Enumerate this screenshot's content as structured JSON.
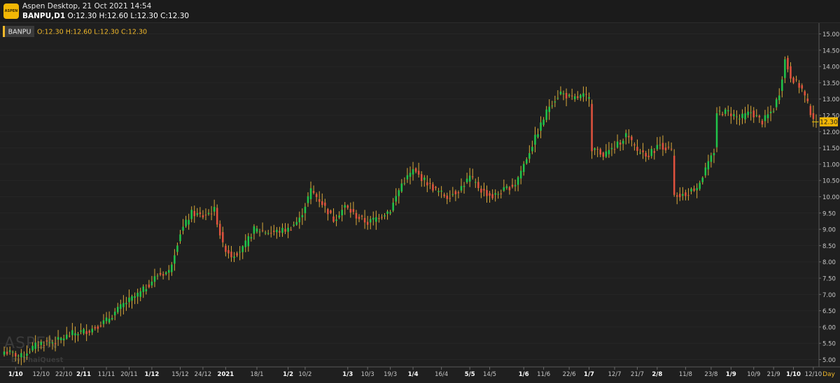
{
  "window": {
    "title": "Aspen Desktop, 21 Oct 2021 14:54",
    "symbol_line": "BANPU,D1",
    "ohlc_line": "O:12.30 H:12.60 L:12.30 C:12.30",
    "app_icon_label": "ASPEN"
  },
  "legend": {
    "symbol": "BANPU",
    "ohlc": "O:12.30 H:12.60 L:12.30 C:12.30"
  },
  "watermark": {
    "brand": "ASPEN",
    "sub": "by ThaiQuest"
  },
  "colors": {
    "up": "#21c44a",
    "down": "#e0523e",
    "wick": "#d9a93a",
    "legend_text": "#f0b82a",
    "price_tag": "#f2b705",
    "axis_text": "#c8c8c8"
  },
  "chart_data": {
    "type": "candlestick",
    "symbol": "BANPU",
    "timeframe": "D1",
    "title": "BANPU,D1",
    "ylim": [
      4.75,
      15.1
    ],
    "y_ticks": [
      5.0,
      5.5,
      6.0,
      6.5,
      7.0,
      7.5,
      8.0,
      8.5,
      9.0,
      9.5,
      10.0,
      10.5,
      11.0,
      11.5,
      12.0,
      12.5,
      13.0,
      13.5,
      14.0,
      14.5,
      15.0
    ],
    "last_price": "12.30",
    "period_label": "Day",
    "x_ticks": [
      {
        "label": "1/10",
        "bold": true
      },
      {
        "label": "12/10",
        "bold": false
      },
      {
        "label": "22/10",
        "bold": false
      },
      {
        "label": "2/11",
        "bold": true
      },
      {
        "label": "11/11",
        "bold": false
      },
      {
        "label": "20/11",
        "bold": false
      },
      {
        "label": "1/12",
        "bold": true
      },
      {
        "label": "15/12",
        "bold": false
      },
      {
        "label": "24/12",
        "bold": false
      },
      {
        "label": "2021",
        "bold": true
      },
      {
        "label": "18/1",
        "bold": false
      },
      {
        "label": "1/2",
        "bold": true
      },
      {
        "label": "10/2",
        "bold": false
      },
      {
        "label": "1/3",
        "bold": true
      },
      {
        "label": "10/3",
        "bold": false
      },
      {
        "label": "19/3",
        "bold": false
      },
      {
        "label": "1/4",
        "bold": true
      },
      {
        "label": "16/4",
        "bold": false
      },
      {
        "label": "5/5",
        "bold": true
      },
      {
        "label": "14/5",
        "bold": false
      },
      {
        "label": "1/6",
        "bold": true
      },
      {
        "label": "11/6",
        "bold": false
      },
      {
        "label": "22/6",
        "bold": false
      },
      {
        "label": "1/7",
        "bold": true
      },
      {
        "label": "12/7",
        "bold": false
      },
      {
        "label": "21/7",
        "bold": false
      },
      {
        "label": "2/8",
        "bold": true
      },
      {
        "label": "11/8",
        "bold": false
      },
      {
        "label": "23/8",
        "bold": false
      },
      {
        "label": "1/9",
        "bold": true
      },
      {
        "label": "10/9",
        "bold": false
      },
      {
        "label": "21/9",
        "bold": false
      },
      {
        "label": "1/10",
        "bold": true
      },
      {
        "label": "12/10",
        "bold": false
      }
    ],
    "tick_bar_index": [
      4,
      13,
      21,
      28,
      36,
      44,
      52,
      62,
      70,
      78,
      89,
      100,
      106,
      121,
      128,
      136,
      144,
      154,
      164,
      171,
      183,
      190,
      199,
      206,
      215,
      223,
      230,
      240,
      249,
      256,
      264,
      271,
      278,
      285
    ],
    "close_anchors": [
      [
        0,
        5.25
      ],
      [
        6,
        5.1
      ],
      [
        12,
        5.5
      ],
      [
        18,
        5.55
      ],
      [
        24,
        5.8
      ],
      [
        30,
        5.9
      ],
      [
        36,
        6.2
      ],
      [
        42,
        6.7
      ],
      [
        48,
        7.05
      ],
      [
        54,
        7.6
      ],
      [
        58,
        7.7
      ],
      [
        62,
        8.9
      ],
      [
        66,
        9.5
      ],
      [
        70,
        9.4
      ],
      [
        74,
        9.6
      ],
      [
        77,
        8.5
      ],
      [
        80,
        8.2
      ],
      [
        84,
        8.4
      ],
      [
        88,
        9.0
      ],
      [
        94,
        8.9
      ],
      [
        100,
        9.0
      ],
      [
        104,
        9.3
      ],
      [
        108,
        10.2
      ],
      [
        112,
        9.8
      ],
      [
        116,
        9.3
      ],
      [
        120,
        9.7
      ],
      [
        124,
        9.4
      ],
      [
        128,
        9.2
      ],
      [
        132,
        9.4
      ],
      [
        136,
        9.6
      ],
      [
        140,
        10.4
      ],
      [
        144,
        10.8
      ],
      [
        148,
        10.5
      ],
      [
        152,
        10.2
      ],
      [
        156,
        10.0
      ],
      [
        160,
        10.2
      ],
      [
        164,
        10.6
      ],
      [
        168,
        10.2
      ],
      [
        172,
        10.0
      ],
      [
        176,
        10.2
      ],
      [
        180,
        10.4
      ],
      [
        184,
        11.2
      ],
      [
        188,
        12.0
      ],
      [
        192,
        12.8
      ],
      [
        196,
        13.2
      ],
      [
        200,
        13.0
      ],
      [
        204,
        13.1
      ],
      [
        206,
        13.0
      ],
      [
        207,
        11.5
      ],
      [
        211,
        11.3
      ],
      [
        215,
        11.5
      ],
      [
        219,
        11.9
      ],
      [
        223,
        11.4
      ],
      [
        227,
        11.3
      ],
      [
        231,
        11.6
      ],
      [
        235,
        11.4
      ],
      [
        236,
        10.0
      ],
      [
        240,
        10.1
      ],
      [
        244,
        10.3
      ],
      [
        248,
        11.0
      ],
      [
        250,
        11.4
      ],
      [
        251,
        12.6
      ],
      [
        255,
        12.6
      ],
      [
        259,
        12.4
      ],
      [
        263,
        12.6
      ],
      [
        267,
        12.3
      ],
      [
        271,
        12.7
      ],
      [
        273,
        13.2
      ],
      [
        275,
        14.2
      ],
      [
        277,
        13.7
      ],
      [
        281,
        13.3
      ],
      [
        284,
        12.6
      ],
      [
        286,
        12.3
      ]
    ],
    "bars_total": 287
  }
}
